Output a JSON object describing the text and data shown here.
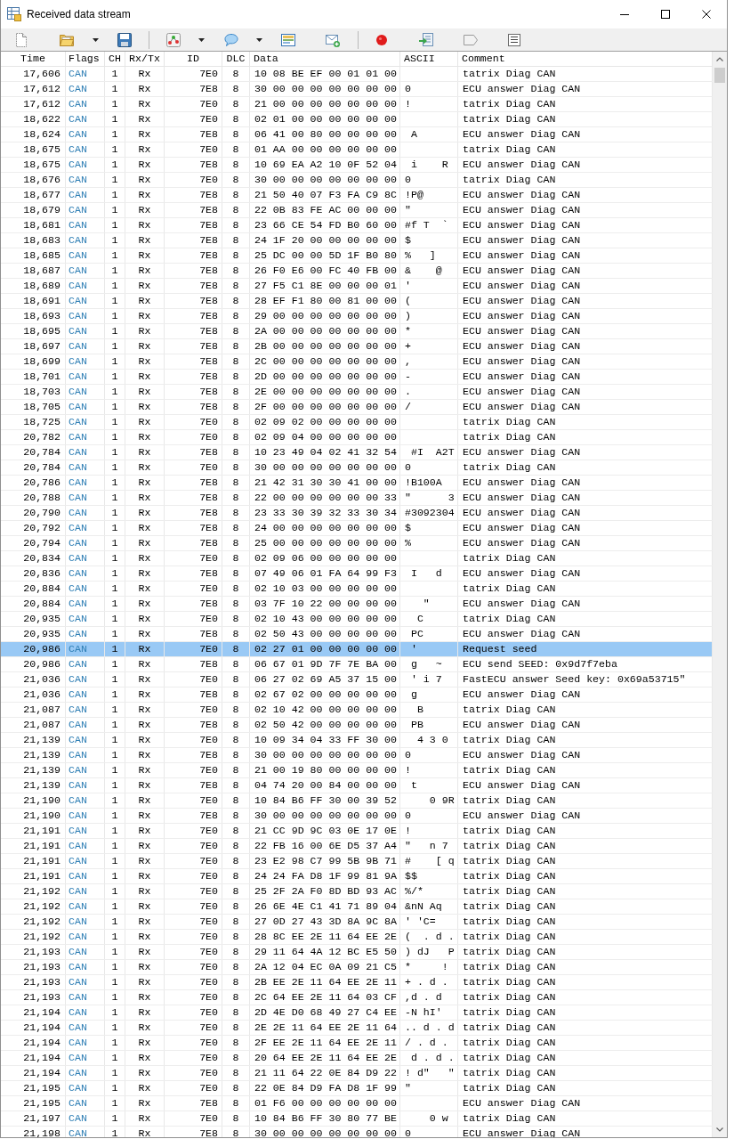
{
  "window": {
    "title": "Received data stream"
  },
  "table": {
    "columns": [
      "Time",
      "Flags",
      "CH",
      "Rx/Tx",
      "ID",
      "DLC",
      "Data",
      "ASCII",
      "Comment"
    ],
    "rows": [
      {
        "time": "17,606",
        "flags": "CAN",
        "ch": "1",
        "rx_tx": "Rx",
        "id": "7E0",
        "dlc": "8",
        "data": "10 08 BE EF 00 01 01 00",
        "comment": "tatrix Diag CAN",
        "selected": false
      },
      {
        "time": "17,612",
        "flags": "CAN",
        "ch": "1",
        "rx_tx": "Rx",
        "id": "7E8",
        "dlc": "8",
        "data": "30 00 00 00 00 00 00 00",
        "ascii": "0",
        "comment": "ECU answer Diag CAN",
        "selected": false
      },
      {
        "time": "17,612",
        "flags": "CAN",
        "ch": "1",
        "rx_tx": "Rx",
        "id": "7E0",
        "dlc": "8",
        "data": "21 00 00 00 00 00 00 00",
        "ascii": "!",
        "comment": "tatrix Diag CAN",
        "selected": false
      },
      {
        "time": "18,622",
        "flags": "CAN",
        "ch": "1",
        "rx_tx": "Rx",
        "id": "7E0",
        "dlc": "8",
        "data": "02 01 00 00 00 00 00 00",
        "comment": "tatrix Diag CAN",
        "selected": false
      },
      {
        "time": "18,624",
        "flags": "CAN",
        "ch": "1",
        "rx_tx": "Rx",
        "id": "7E8",
        "dlc": "8",
        "data": "06 41 00 80 00 00 00 00",
        "ascii": " A",
        "comment": "ECU answer Diag CAN",
        "selected": false
      },
      {
        "time": "18,675",
        "flags": "CAN",
        "ch": "1",
        "rx_tx": "Rx",
        "id": "7E0",
        "dlc": "8",
        "data": "01 AA 00 00 00 00 00 00",
        "comment": "tatrix Diag CAN",
        "selected": false
      },
      {
        "time": "18,675",
        "flags": "CAN",
        "ch": "1",
        "rx_tx": "Rx",
        "id": "7E8",
        "dlc": "8",
        "data": "10 69 EA A2 10 0F 52 04",
        "ascii": " i    R",
        "comment": "ECU answer Diag CAN",
        "selected": false
      },
      {
        "time": "18,676",
        "flags": "CAN",
        "ch": "1",
        "rx_tx": "Rx",
        "id": "7E0",
        "dlc": "8",
        "data": "30 00 00 00 00 00 00 00",
        "ascii": "0",
        "comment": "tatrix Diag CAN",
        "selected": false
      },
      {
        "time": "18,677",
        "flags": "CAN",
        "ch": "1",
        "rx_tx": "Rx",
        "id": "7E8",
        "dlc": "8",
        "data": "21 50 40 07 F3 FA C9 8C",
        "ascii": "!P@",
        "comment": "ECU answer Diag CAN",
        "selected": false
      },
      {
        "time": "18,679",
        "flags": "CAN",
        "ch": "1",
        "rx_tx": "Rx",
        "id": "7E8",
        "dlc": "8",
        "data": "22 0B 83 FE AC 00 00 00",
        "ascii": "\"",
        "comment": "ECU answer Diag CAN",
        "selected": false
      },
      {
        "time": "18,681",
        "flags": "CAN",
        "ch": "1",
        "rx_tx": "Rx",
        "id": "7E8",
        "dlc": "8",
        "data": "23 66 CE 54 FD B0 60 00",
        "ascii": "#f T  `",
        "comment": "ECU answer Diag CAN",
        "selected": false
      },
      {
        "time": "18,683",
        "flags": "CAN",
        "ch": "1",
        "rx_tx": "Rx",
        "id": "7E8",
        "dlc": "8",
        "data": "24 1F 20 00 00 00 00 00",
        "ascii": "$",
        "comment": "ECU answer Diag CAN",
        "selected": false
      },
      {
        "time": "18,685",
        "flags": "CAN",
        "ch": "1",
        "rx_tx": "Rx",
        "id": "7E8",
        "dlc": "8",
        "data": "25 DC 00 00 5D 1F B0 80",
        "ascii": "%   ]",
        "comment": "ECU answer Diag CAN",
        "selected": false
      },
      {
        "time": "18,687",
        "flags": "CAN",
        "ch": "1",
        "rx_tx": "Rx",
        "id": "7E8",
        "dlc": "8",
        "data": "26 F0 E6 00 FC 40 FB 00",
        "ascii": "&    @",
        "comment": "ECU answer Diag CAN",
        "selected": false
      },
      {
        "time": "18,689",
        "flags": "CAN",
        "ch": "1",
        "rx_tx": "Rx",
        "id": "7E8",
        "dlc": "8",
        "data": "27 F5 C1 8E 00 00 00 01",
        "ascii": "'",
        "comment": "ECU answer Diag CAN",
        "selected": false
      },
      {
        "time": "18,691",
        "flags": "CAN",
        "ch": "1",
        "rx_tx": "Rx",
        "id": "7E8",
        "dlc": "8",
        "data": "28 EF F1 80 00 81 00 00",
        "ascii": "(",
        "comment": "ECU answer Diag CAN",
        "selected": false
      },
      {
        "time": "18,693",
        "flags": "CAN",
        "ch": "1",
        "rx_tx": "Rx",
        "id": "7E8",
        "dlc": "8",
        "data": "29 00 00 00 00 00 00 00",
        "ascii": ")",
        "comment": "ECU answer Diag CAN",
        "selected": false
      },
      {
        "time": "18,695",
        "flags": "CAN",
        "ch": "1",
        "rx_tx": "Rx",
        "id": "7E8",
        "dlc": "8",
        "data": "2A 00 00 00 00 00 00 00",
        "ascii": "*",
        "comment": "ECU answer Diag CAN",
        "selected": false
      },
      {
        "time": "18,697",
        "flags": "CAN",
        "ch": "1",
        "rx_tx": "Rx",
        "id": "7E8",
        "dlc": "8",
        "data": "2B 00 00 00 00 00 00 00",
        "ascii": "+",
        "comment": "ECU answer Diag CAN",
        "selected": false
      },
      {
        "time": "18,699",
        "flags": "CAN",
        "ch": "1",
        "rx_tx": "Rx",
        "id": "7E8",
        "dlc": "8",
        "data": "2C 00 00 00 00 00 00 00",
        "ascii": ",",
        "comment": "ECU answer Diag CAN",
        "selected": false
      },
      {
        "time": "18,701",
        "flags": "CAN",
        "ch": "1",
        "rx_tx": "Rx",
        "id": "7E8",
        "dlc": "8",
        "data": "2D 00 00 00 00 00 00 00",
        "ascii": "-",
        "comment": "ECU answer Diag CAN",
        "selected": false
      },
      {
        "time": "18,703",
        "flags": "CAN",
        "ch": "1",
        "rx_tx": "Rx",
        "id": "7E8",
        "dlc": "8",
        "data": "2E 00 00 00 00 00 00 00",
        "ascii": ".",
        "comment": "ECU answer Diag CAN",
        "selected": false
      },
      {
        "time": "18,705",
        "flags": "CAN",
        "ch": "1",
        "rx_tx": "Rx",
        "id": "7E8",
        "dlc": "8",
        "data": "2F 00 00 00 00 00 00 00",
        "ascii": "/",
        "comment": "ECU answer Diag CAN",
        "selected": false
      },
      {
        "time": "18,725",
        "flags": "CAN",
        "ch": "1",
        "rx_tx": "Rx",
        "id": "7E0",
        "dlc": "8",
        "data": "02 09 02 00 00 00 00 00",
        "comment": "tatrix Diag CAN",
        "selected": false
      },
      {
        "time": "20,782",
        "flags": "CAN",
        "ch": "1",
        "rx_tx": "Rx",
        "id": "7E0",
        "dlc": "8",
        "data": "02 09 04 00 00 00 00 00",
        "comment": "tatrix Diag CAN",
        "selected": false
      },
      {
        "time": "20,784",
        "flags": "CAN",
        "ch": "1",
        "rx_tx": "Rx",
        "id": "7E8",
        "dlc": "8",
        "data": "10 23 49 04 02 41 32 54",
        "ascii": " #I  A2T",
        "comment": "ECU answer Diag CAN",
        "selected": false
      },
      {
        "time": "20,784",
        "flags": "CAN",
        "ch": "1",
        "rx_tx": "Rx",
        "id": "7E0",
        "dlc": "8",
        "data": "30 00 00 00 00 00 00 00",
        "ascii": "0",
        "comment": "tatrix Diag CAN",
        "selected": false
      },
      {
        "time": "20,786",
        "flags": "CAN",
        "ch": "1",
        "rx_tx": "Rx",
        "id": "7E8",
        "dlc": "8",
        "data": "21 42 31 30 30 41 00 00",
        "ascii": "!B100A",
        "comment": "ECU answer Diag CAN",
        "selected": false
      },
      {
        "time": "20,788",
        "flags": "CAN",
        "ch": "1",
        "rx_tx": "Rx",
        "id": "7E8",
        "dlc": "8",
        "data": "22 00 00 00 00 00 00 33",
        "ascii": "\"      3",
        "comment": "ECU answer Diag CAN",
        "selected": false
      },
      {
        "time": "20,790",
        "flags": "CAN",
        "ch": "1",
        "rx_tx": "Rx",
        "id": "7E8",
        "dlc": "8",
        "data": "23 33 30 39 32 33 30 34",
        "ascii": "#3092304",
        "comment": "ECU answer Diag CAN",
        "selected": false
      },
      {
        "time": "20,792",
        "flags": "CAN",
        "ch": "1",
        "rx_tx": "Rx",
        "id": "7E8",
        "dlc": "8",
        "data": "24 00 00 00 00 00 00 00",
        "ascii": "$",
        "comment": "ECU answer Diag CAN",
        "selected": false
      },
      {
        "time": "20,794",
        "flags": "CAN",
        "ch": "1",
        "rx_tx": "Rx",
        "id": "7E8",
        "dlc": "8",
        "data": "25 00 00 00 00 00 00 00",
        "ascii": "%",
        "comment": "ECU answer Diag CAN",
        "selected": false
      },
      {
        "time": "20,834",
        "flags": "CAN",
        "ch": "1",
        "rx_tx": "Rx",
        "id": "7E0",
        "dlc": "8",
        "data": "02 09 06 00 00 00 00 00",
        "comment": "tatrix Diag CAN",
        "selected": false
      },
      {
        "time": "20,836",
        "flags": "CAN",
        "ch": "1",
        "rx_tx": "Rx",
        "id": "7E8",
        "dlc": "8",
        "data": "07 49 06 01 FA 64 99 F3",
        "ascii": " I   d",
        "comment": "ECU answer Diag CAN",
        "selected": false
      },
      {
        "time": "20,884",
        "flags": "CAN",
        "ch": "1",
        "rx_tx": "Rx",
        "id": "7E0",
        "dlc": "8",
        "data": "02 10 03 00 00 00 00 00",
        "comment": "tatrix Diag CAN",
        "selected": false
      },
      {
        "time": "20,884",
        "flags": "CAN",
        "ch": "1",
        "rx_tx": "Rx",
        "id": "7E8",
        "dlc": "8",
        "data": "03 7F 10 22 00 00 00 00",
        "ascii": "   \"",
        "comment": "ECU answer Diag CAN",
        "selected": false
      },
      {
        "time": "20,935",
        "flags": "CAN",
        "ch": "1",
        "rx_tx": "Rx",
        "id": "7E0",
        "dlc": "8",
        "data": "02 10 43 00 00 00 00 00",
        "ascii": "  C",
        "comment": "tatrix Diag CAN",
        "selected": false
      },
      {
        "time": "20,935",
        "flags": "CAN",
        "ch": "1",
        "rx_tx": "Rx",
        "id": "7E8",
        "dlc": "8",
        "data": "02 50 43 00 00 00 00 00",
        "ascii": " PC",
        "comment": "ECU answer Diag CAN",
        "selected": false
      },
      {
        "time": "20,986",
        "flags": "CAN",
        "ch": "1",
        "rx_tx": "Rx",
        "id": "7E0",
        "dlc": "8",
        "data": "02 27 01 00 00 00 00 00",
        "ascii": " '",
        "comment": "Request seed",
        "selected": true
      },
      {
        "time": "20,986",
        "flags": "CAN",
        "ch": "1",
        "rx_tx": "Rx",
        "id": "7E8",
        "dlc": "8",
        "data": "06 67 01 9D 7F 7E BA 00",
        "ascii": " g   ~",
        "comment": "ECU send SEED: 0x9d7f7eba",
        "selected": false
      },
      {
        "time": "21,036",
        "flags": "CAN",
        "ch": "1",
        "rx_tx": "Rx",
        "id": "7E0",
        "dlc": "8",
        "data": "06 27 02 69 A5 37 15 00",
        "ascii": " ' i 7",
        "comment": "FastECU answer Seed key: 0x69a53715\"",
        "selected": false
      },
      {
        "time": "21,036",
        "flags": "CAN",
        "ch": "1",
        "rx_tx": "Rx",
        "id": "7E8",
        "dlc": "8",
        "data": "02 67 02 00 00 00 00 00",
        "ascii": " g",
        "comment": "ECU answer Diag CAN",
        "selected": false
      },
      {
        "time": "21,087",
        "flags": "CAN",
        "ch": "1",
        "rx_tx": "Rx",
        "id": "7E0",
        "dlc": "8",
        "data": "02 10 42 00 00 00 00 00",
        "ascii": "  B",
        "comment": "tatrix Diag CAN",
        "selected": false
      },
      {
        "time": "21,087",
        "flags": "CAN",
        "ch": "1",
        "rx_tx": "Rx",
        "id": "7E8",
        "dlc": "8",
        "data": "02 50 42 00 00 00 00 00",
        "ascii": " PB",
        "comment": "ECU answer Diag CAN",
        "selected": false
      },
      {
        "time": "21,139",
        "flags": "CAN",
        "ch": "1",
        "rx_tx": "Rx",
        "id": "7E0",
        "dlc": "8",
        "data": "10 09 34 04 33 FF 30 00",
        "ascii": "  4 3 0",
        "comment": "tatrix Diag CAN",
        "selected": false
      },
      {
        "time": "21,139",
        "flags": "CAN",
        "ch": "1",
        "rx_tx": "Rx",
        "id": "7E8",
        "dlc": "8",
        "data": "30 00 00 00 00 00 00 00",
        "ascii": "0",
        "comment": "ECU answer Diag CAN",
        "selected": false
      },
      {
        "time": "21,139",
        "flags": "CAN",
        "ch": "1",
        "rx_tx": "Rx",
        "id": "7E0",
        "dlc": "8",
        "data": "21 00 19 80 00 00 00 00",
        "ascii": "!",
        "comment": "tatrix Diag CAN",
        "selected": false
      },
      {
        "time": "21,139",
        "flags": "CAN",
        "ch": "1",
        "rx_tx": "Rx",
        "id": "7E8",
        "dlc": "8",
        "data": "04 74 20 00 84 00 00 00",
        "ascii": " t",
        "comment": "ECU answer Diag CAN",
        "selected": false
      },
      {
        "time": "21,190",
        "flags": "CAN",
        "ch": "1",
        "rx_tx": "Rx",
        "id": "7E0",
        "dlc": "8",
        "data": "10 84 B6 FF 30 00 39 52",
        "ascii": "    0 9R",
        "comment": "tatrix Diag CAN",
        "selected": false
      },
      {
        "time": "21,190",
        "flags": "CAN",
        "ch": "1",
        "rx_tx": "Rx",
        "id": "7E8",
        "dlc": "8",
        "data": "30 00 00 00 00 00 00 00",
        "ascii": "0",
        "comment": "ECU answer Diag CAN",
        "selected": false
      },
      {
        "time": "21,191",
        "flags": "CAN",
        "ch": "1",
        "rx_tx": "Rx",
        "id": "7E0",
        "dlc": "8",
        "data": "21 CC 9D 9C 03 0E 17 0E",
        "ascii": "!",
        "comment": "tatrix Diag CAN",
        "selected": false
      },
      {
        "time": "21,191",
        "flags": "CAN",
        "ch": "1",
        "rx_tx": "Rx",
        "id": "7E0",
        "dlc": "8",
        "data": "22 FB 16 00 6E D5 37 A4",
        "ascii": "\"   n 7",
        "comment": "tatrix Diag CAN",
        "selected": false
      },
      {
        "time": "21,191",
        "flags": "CAN",
        "ch": "1",
        "rx_tx": "Rx",
        "id": "7E0",
        "dlc": "8",
        "data": "23 E2 98 C7 99 5B 9B 71",
        "ascii": "#    [ q",
        "comment": "tatrix Diag CAN",
        "selected": false
      },
      {
        "time": "21,191",
        "flags": "CAN",
        "ch": "1",
        "rx_tx": "Rx",
        "id": "7E0",
        "dlc": "8",
        "data": "24 24 FA D8 1F 99 81 9A",
        "ascii": "$$",
        "comment": "tatrix Diag CAN",
        "selected": false
      },
      {
        "time": "21,192",
        "flags": "CAN",
        "ch": "1",
        "rx_tx": "Rx",
        "id": "7E0",
        "dlc": "8",
        "data": "25 2F 2A F0 8D BD 93 AC",
        "ascii": "%/*",
        "comment": "tatrix Diag CAN",
        "selected": false
      },
      {
        "time": "21,192",
        "flags": "CAN",
        "ch": "1",
        "rx_tx": "Rx",
        "id": "7E0",
        "dlc": "8",
        "data": "26 6E 4E C1 41 71 89 04",
        "ascii": "&nN Aq",
        "comment": "tatrix Diag CAN",
        "selected": false
      },
      {
        "time": "21,192",
        "flags": "CAN",
        "ch": "1",
        "rx_tx": "Rx",
        "id": "7E0",
        "dlc": "8",
        "data": "27 0D 27 43 3D 8A 9C 8A",
        "ascii": "' 'C=",
        "comment": "tatrix Diag CAN",
        "selected": false
      },
      {
        "time": "21,192",
        "flags": "CAN",
        "ch": "1",
        "rx_tx": "Rx",
        "id": "7E0",
        "dlc": "8",
        "data": "28 8C EE 2E 11 64 EE 2E",
        "ascii": "(  . d .",
        "comment": "tatrix Diag CAN",
        "selected": false
      },
      {
        "time": "21,193",
        "flags": "CAN",
        "ch": "1",
        "rx_tx": "Rx",
        "id": "7E0",
        "dlc": "8",
        "data": "29 11 64 4A 12 BC E5 50",
        "ascii": ") dJ   P",
        "comment": "tatrix Diag CAN",
        "selected": false
      },
      {
        "time": "21,193",
        "flags": "CAN",
        "ch": "1",
        "rx_tx": "Rx",
        "id": "7E0",
        "dlc": "8",
        "data": "2A 12 04 EC 0A 09 21 C5",
        "ascii": "*     !",
        "comment": "tatrix Diag CAN",
        "selected": false
      },
      {
        "time": "21,193",
        "flags": "CAN",
        "ch": "1",
        "rx_tx": "Rx",
        "id": "7E0",
        "dlc": "8",
        "data": "2B EE 2E 11 64 EE 2E 11",
        "ascii": "+ . d .",
        "comment": "tatrix Diag CAN",
        "selected": false
      },
      {
        "time": "21,193",
        "flags": "CAN",
        "ch": "1",
        "rx_tx": "Rx",
        "id": "7E0",
        "dlc": "8",
        "data": "2C 64 EE 2E 11 64 03 CF",
        "ascii": ",d . d",
        "comment": "tatrix Diag CAN",
        "selected": false
      },
      {
        "time": "21,194",
        "flags": "CAN",
        "ch": "1",
        "rx_tx": "Rx",
        "id": "7E0",
        "dlc": "8",
        "data": "2D 4E D0 68 49 27 C4 EE",
        "ascii": "-N hI'",
        "comment": "tatrix Diag CAN",
        "selected": false
      },
      {
        "time": "21,194",
        "flags": "CAN",
        "ch": "1",
        "rx_tx": "Rx",
        "id": "7E0",
        "dlc": "8",
        "data": "2E 2E 11 64 EE 2E 11 64",
        "ascii": ".. d . d",
        "comment": "tatrix Diag CAN",
        "selected": false
      },
      {
        "time": "21,194",
        "flags": "CAN",
        "ch": "1",
        "rx_tx": "Rx",
        "id": "7E0",
        "dlc": "8",
        "data": "2F EE 2E 11 64 EE 2E 11",
        "ascii": "/ . d .",
        "comment": "tatrix Diag CAN",
        "selected": false
      },
      {
        "time": "21,194",
        "flags": "CAN",
        "ch": "1",
        "rx_tx": "Rx",
        "id": "7E0",
        "dlc": "8",
        "data": "20 64 EE 2E 11 64 EE 2E",
        "ascii": " d . d .",
        "comment": "tatrix Diag CAN",
        "selected": false
      },
      {
        "time": "21,194",
        "flags": "CAN",
        "ch": "1",
        "rx_tx": "Rx",
        "id": "7E0",
        "dlc": "8",
        "data": "21 11 64 22 0E 84 D9 22",
        "ascii": "! d\"   \"",
        "comment": "tatrix Diag CAN",
        "selected": false
      },
      {
        "time": "21,195",
        "flags": "CAN",
        "ch": "1",
        "rx_tx": "Rx",
        "id": "7E0",
        "dlc": "8",
        "data": "22 0E 84 D9 FA D8 1F 99",
        "ascii": "\"",
        "comment": "tatrix Diag CAN",
        "selected": false
      },
      {
        "time": "21,195",
        "flags": "CAN",
        "ch": "1",
        "rx_tx": "Rx",
        "id": "7E8",
        "dlc": "8",
        "data": "01 F6 00 00 00 00 00 00",
        "comment": "ECU answer Diag CAN",
        "selected": false
      },
      {
        "time": "21,197",
        "flags": "CAN",
        "ch": "1",
        "rx_tx": "Rx",
        "id": "7E0",
        "dlc": "8",
        "data": "10 84 B6 FF 30 80 77 BE",
        "ascii": "    0 w",
        "comment": "tatrix Diag CAN",
        "selected": false
      },
      {
        "time": "21,198",
        "flags": "CAN",
        "ch": "1",
        "rx_tx": "Rx",
        "id": "7E8",
        "dlc": "8",
        "data": "30 00 00 00 00 00 00 00",
        "ascii": "0",
        "comment": "ECU answer Diag CAN",
        "selected": false
      }
    ]
  }
}
